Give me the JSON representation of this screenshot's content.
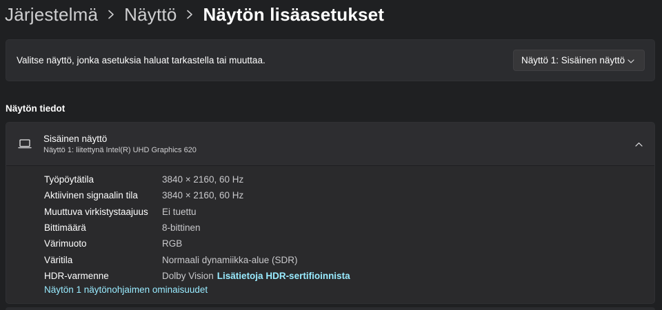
{
  "breadcrumb": {
    "items": [
      "Järjestelmä",
      "Näyttö"
    ],
    "current": "Näytön lisäasetukset"
  },
  "display_select": {
    "prompt": "Valitse näyttö, jonka asetuksia haluat tarkastella tai muuttaa.",
    "selected": "Näyttö 1: Sisäinen näyttö"
  },
  "section": {
    "title": "Näytön tiedot"
  },
  "display_info": {
    "name": "Sisäinen näyttö",
    "subtitle": "Näyttö 1: liitettynä Intel(R) UHD Graphics 620",
    "rows": [
      {
        "label": "Työpöytätila",
        "value": "3840 × 2160, 60 Hz"
      },
      {
        "label": "Aktiivinen signaalin tila",
        "value": "3840 × 2160, 60 Hz"
      },
      {
        "label": "Muuttuva virkistystaajuus",
        "value": "Ei tuettu"
      },
      {
        "label": "Bittimäärä",
        "value": "8-bittinen"
      },
      {
        "label": "Värimuoto",
        "value": "RGB"
      },
      {
        "label": "Väritila",
        "value": "Normaali dynamiikka-alue (SDR)"
      },
      {
        "label": "HDR-varmenne",
        "value": "Dolby Vision",
        "link": "Lisätietoja HDR-sertifioinnista"
      }
    ],
    "adapter_link": "Näytön 1 näytönohjaimen ominaisuudet"
  },
  "icons": {
    "chevron": "chevron-right-icon",
    "display": "laptop-icon",
    "collapse": "chevron-up-icon",
    "dropdown": "chevron-down-icon"
  },
  "colors": {
    "background": "#1f2022",
    "card": "#2b2c2f",
    "link": "#99ebff",
    "text": "#ffffff",
    "muted_text": "#c9c9cc"
  }
}
